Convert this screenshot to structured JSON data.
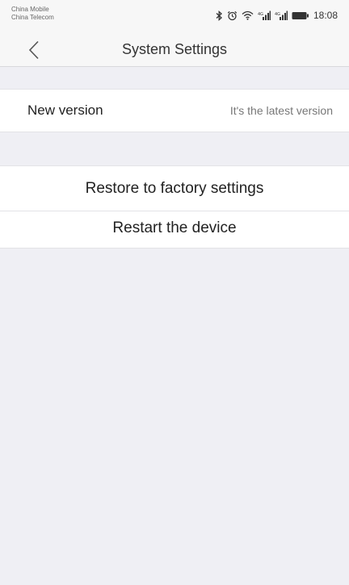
{
  "status_bar": {
    "carrier_1": "China Mobile",
    "carrier_2": "China Telecom",
    "time": "18:08",
    "icons": [
      "bluetooth-icon",
      "alarm-icon",
      "wifi-icon",
      "signal-icon",
      "signal-icon",
      "battery-icon"
    ]
  },
  "nav": {
    "back_icon": "chevron-left-icon",
    "title": "System Settings"
  },
  "settings": {
    "version_label": "New version",
    "version_value": "It's the latest version",
    "restore_label": "Restore to factory settings",
    "restart_label": "Restart the device"
  }
}
